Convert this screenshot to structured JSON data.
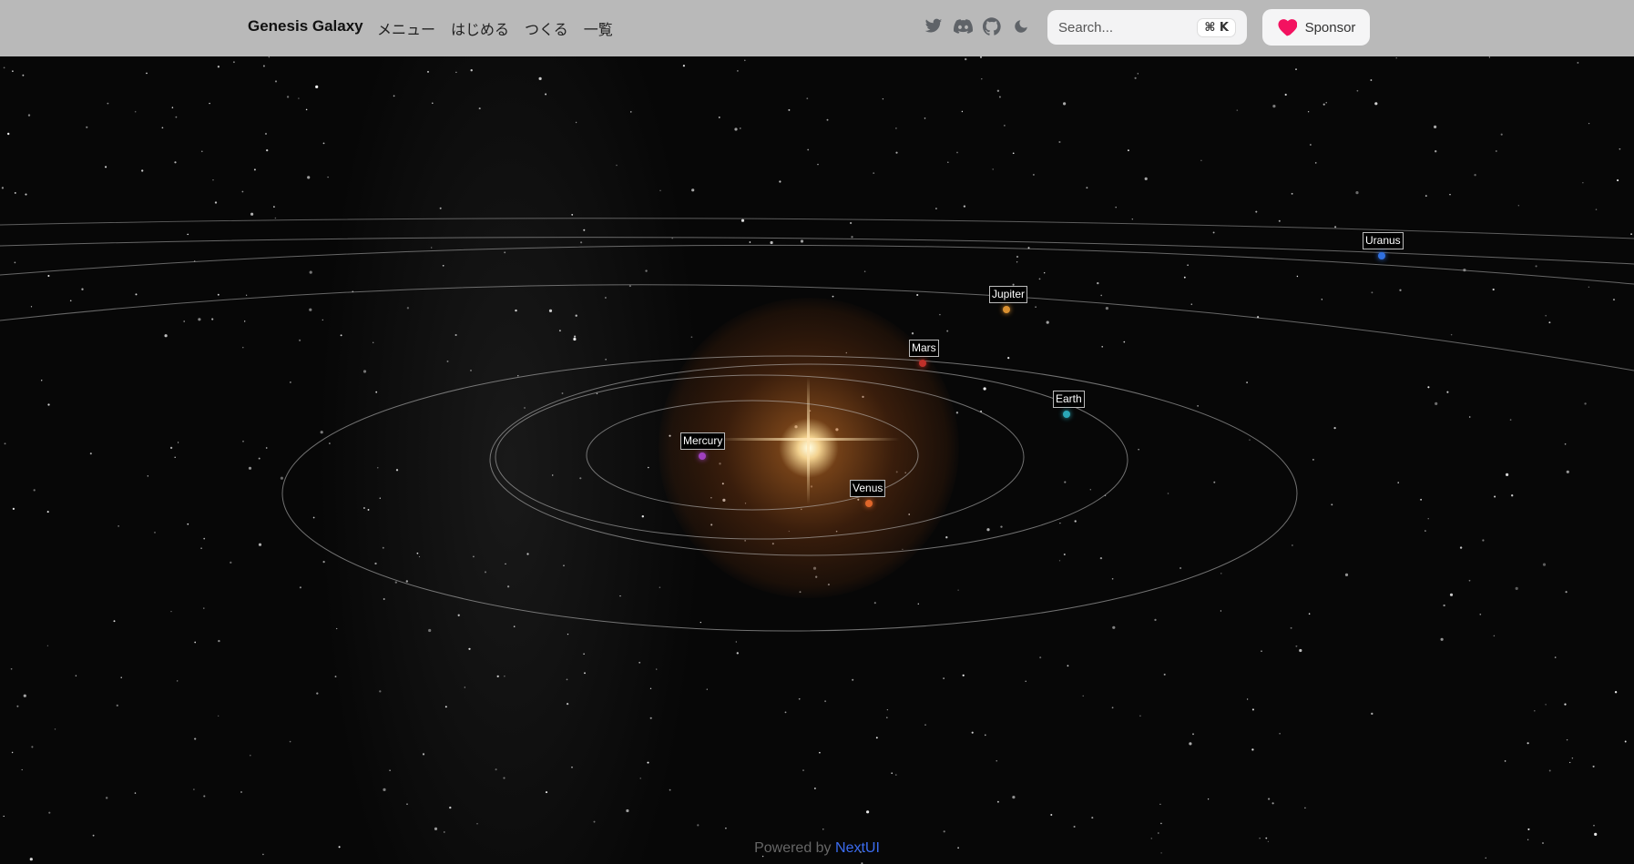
{
  "navbar": {
    "brand": "Genesis Galaxy",
    "links": [
      "メニュー",
      "はじめる",
      "つくる",
      "一覧"
    ],
    "icons": [
      "twitter-icon",
      "discord-icon",
      "github-icon",
      "moon-icon"
    ],
    "search": {
      "placeholder": "Search...",
      "shortcut": "⌘ K"
    },
    "sponsor": {
      "label": "Sponsor",
      "icon": "heart-icon",
      "icon_color": "#f31260"
    }
  },
  "planets": [
    {
      "name": "Mercury",
      "color": "#a040c0"
    },
    {
      "name": "Venus",
      "color": "#e0662a"
    },
    {
      "name": "Earth",
      "color": "#2aa8b8"
    },
    {
      "name": "Mars",
      "color": "#c0302a"
    },
    {
      "name": "Jupiter",
      "color": "#d99030"
    },
    {
      "name": "Uranus",
      "color": "#3070e0"
    }
  ],
  "footer": {
    "prefix": "Powered by",
    "link": "NextUI"
  }
}
